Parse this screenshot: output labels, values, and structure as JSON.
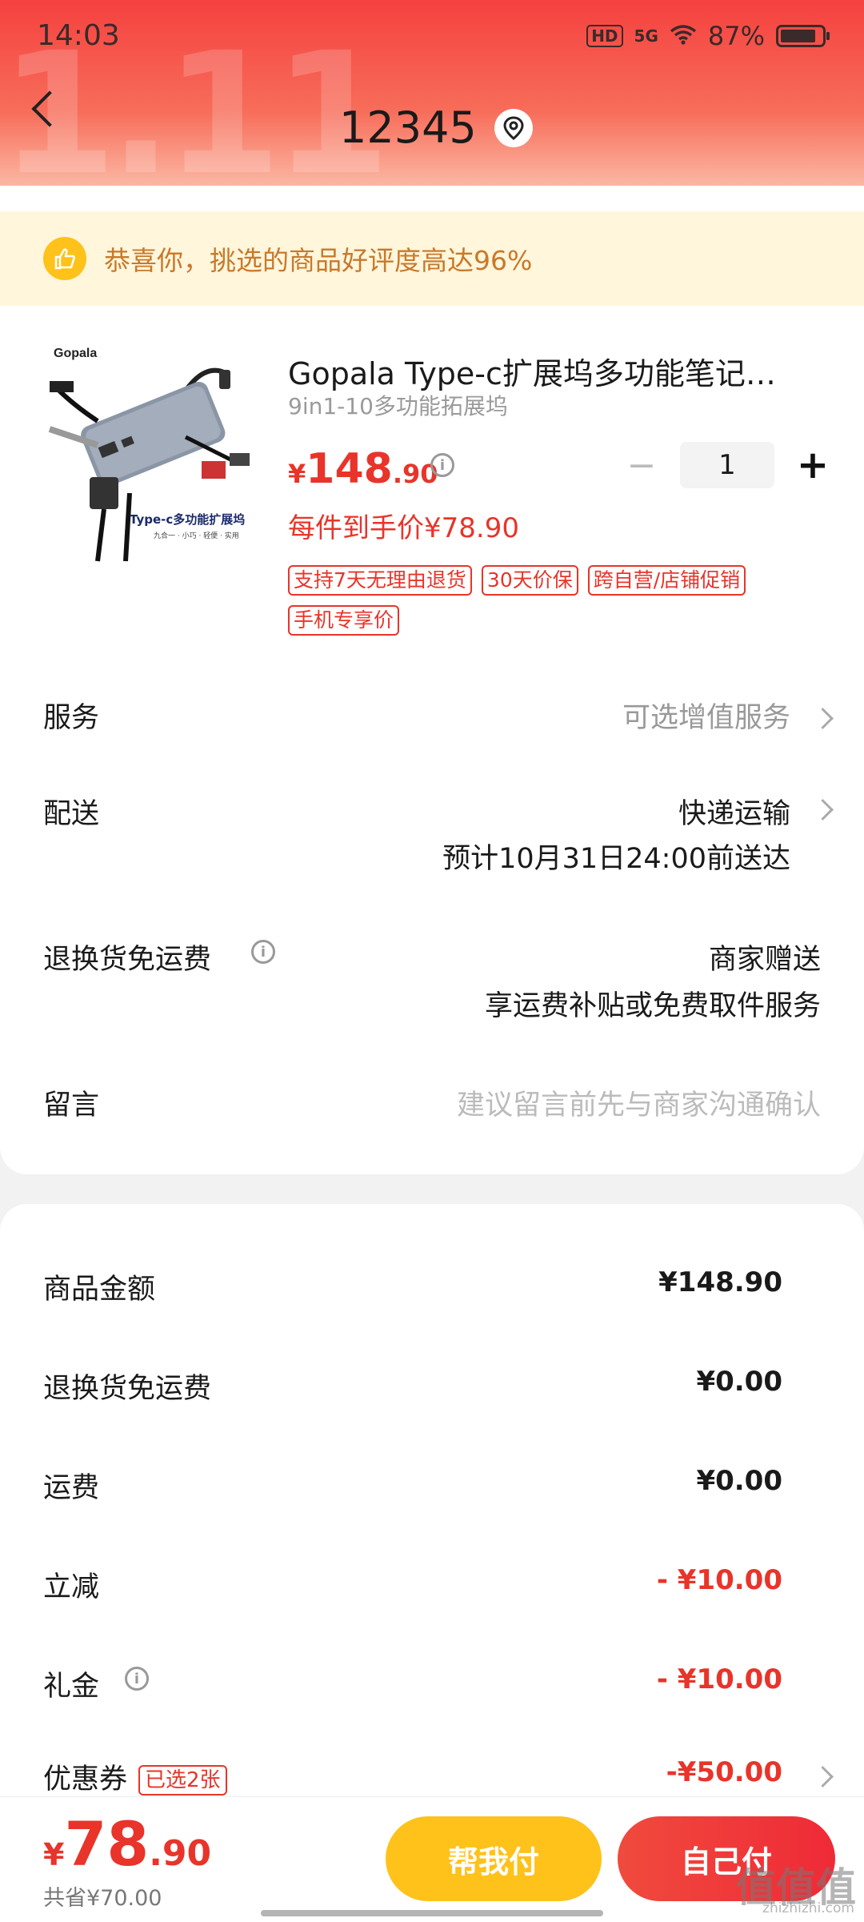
{
  "status_bar": {
    "time": "14:03",
    "hd": "HD",
    "network": "5G",
    "battery": "87%",
    "battery_level": 0.87
  },
  "header": {
    "title": "12345",
    "back_icon": "chevron-left-icon",
    "location_icon": "location-pin-icon"
  },
  "banner": {
    "text": "恭喜你，挑选的商品好评度高达96%",
    "icon": "thumbs-up-icon"
  },
  "product": {
    "image_brand": "Gopala",
    "image_caption": "Type-c多功能扩展坞",
    "image_sub": "九合一 · 小巧 · 轻便 · 实用",
    "title": "Gopala Type-c扩展坞多功能笔记本电脑转换器",
    "spec": "9in1-10多功能拓展坞",
    "price_symbol": "¥",
    "price_int": "148",
    "price_dec": ".90",
    "quantity": "1",
    "minus_label": "−",
    "plus_label": "+",
    "deal_text": "每件到手价¥78.90",
    "tags": [
      "支持7天无理由退货",
      "30天价保",
      "跨自营/店铺促销",
      "手机专享价"
    ]
  },
  "rows": {
    "service_label": "服务",
    "service_value": "可选增值服务",
    "delivery_label": "配送",
    "delivery_value": "快递运输",
    "delivery_eta": "预计10月31日24:00前送达",
    "return_label": "退换货免运费",
    "return_value": "商家赠送",
    "return_desc": "享运费补贴或免费取件服务",
    "message_label": "留言",
    "message_placeholder": "建议留言前先与商家沟通确认"
  },
  "summary": {
    "goods_label": "商品金额",
    "goods_value": "¥148.90",
    "return_label": "退换货免运费",
    "return_value": "¥0.00",
    "shipping_label": "运费",
    "shipping_value": "¥0.00",
    "discount_label": "立减",
    "discount_value": "- ¥10.00",
    "gift_label": "礼金",
    "gift_value": "- ¥10.00",
    "coupon_label": "优惠券",
    "coupon_tag": "已选2张",
    "coupon_value": "-¥50.00"
  },
  "bottom": {
    "total_symbol": "¥",
    "total_int": "78",
    "total_dec": ".90",
    "saved": "共省¥70.00",
    "help_pay": "帮我付",
    "self_pay": "自己付"
  },
  "watermark": {
    "text": "值值值",
    "sub": "zhizhizhi.com"
  },
  "colors": {
    "accent_red": "#e8342a",
    "gold": "#ffc21a"
  }
}
